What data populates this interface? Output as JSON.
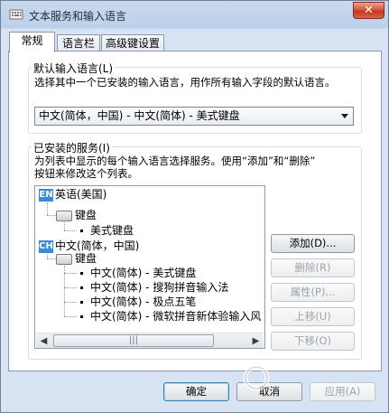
{
  "window": {
    "title": "文本服务和输入语言",
    "close_symbol": "✕"
  },
  "tabs": [
    {
      "label": "常规",
      "active": true
    },
    {
      "label": "语言栏",
      "active": false
    },
    {
      "label": "高级键设置",
      "active": false
    }
  ],
  "default_language": {
    "group_label": "默认输入语言(L)",
    "description": "选择其中一个已安装的输入语言，用作所有输入字段的默认语言。",
    "selected": "中文(简体，中国) - 中文(简体) - 美式键盘"
  },
  "installed_services": {
    "group_label": "已安装的服务(I)",
    "description_line1": "为列表中显示的每个输入语言选择服务。使用“添加”和“删除”",
    "description_line2": "按钮来修改这个列表。",
    "tree": {
      "lang1": {
        "badge": "EN",
        "label": "英语(美国)"
      },
      "lang1_keyboard": "键盘",
      "lang1_items": [
        "美式键盘"
      ],
      "lang2": {
        "badge": "CH",
        "label": "中文(简体，中国)"
      },
      "lang2_keyboard": "键盘",
      "lang2_items": [
        "中文(简体) - 美式键盘",
        "中文(简体) - 搜狗拼音输入法",
        "中文(简体) - 极点五笔",
        "中文(简体) - 微软拼音新体验输入风"
      ]
    },
    "scroll_left": "◀",
    "scroll_right": "▶",
    "scroll_grip": "|||",
    "buttons": {
      "add": "添加(D)...",
      "remove": "删除(R)",
      "properties": "属性(P)...",
      "move_up": "上移(U)",
      "move_down": "下移(O)"
    }
  },
  "footer": {
    "ok": "确定",
    "cancel": "取消",
    "apply": "应用(A)"
  },
  "colors": {
    "accent": "#3a8ad8",
    "close": "#c2381f"
  }
}
